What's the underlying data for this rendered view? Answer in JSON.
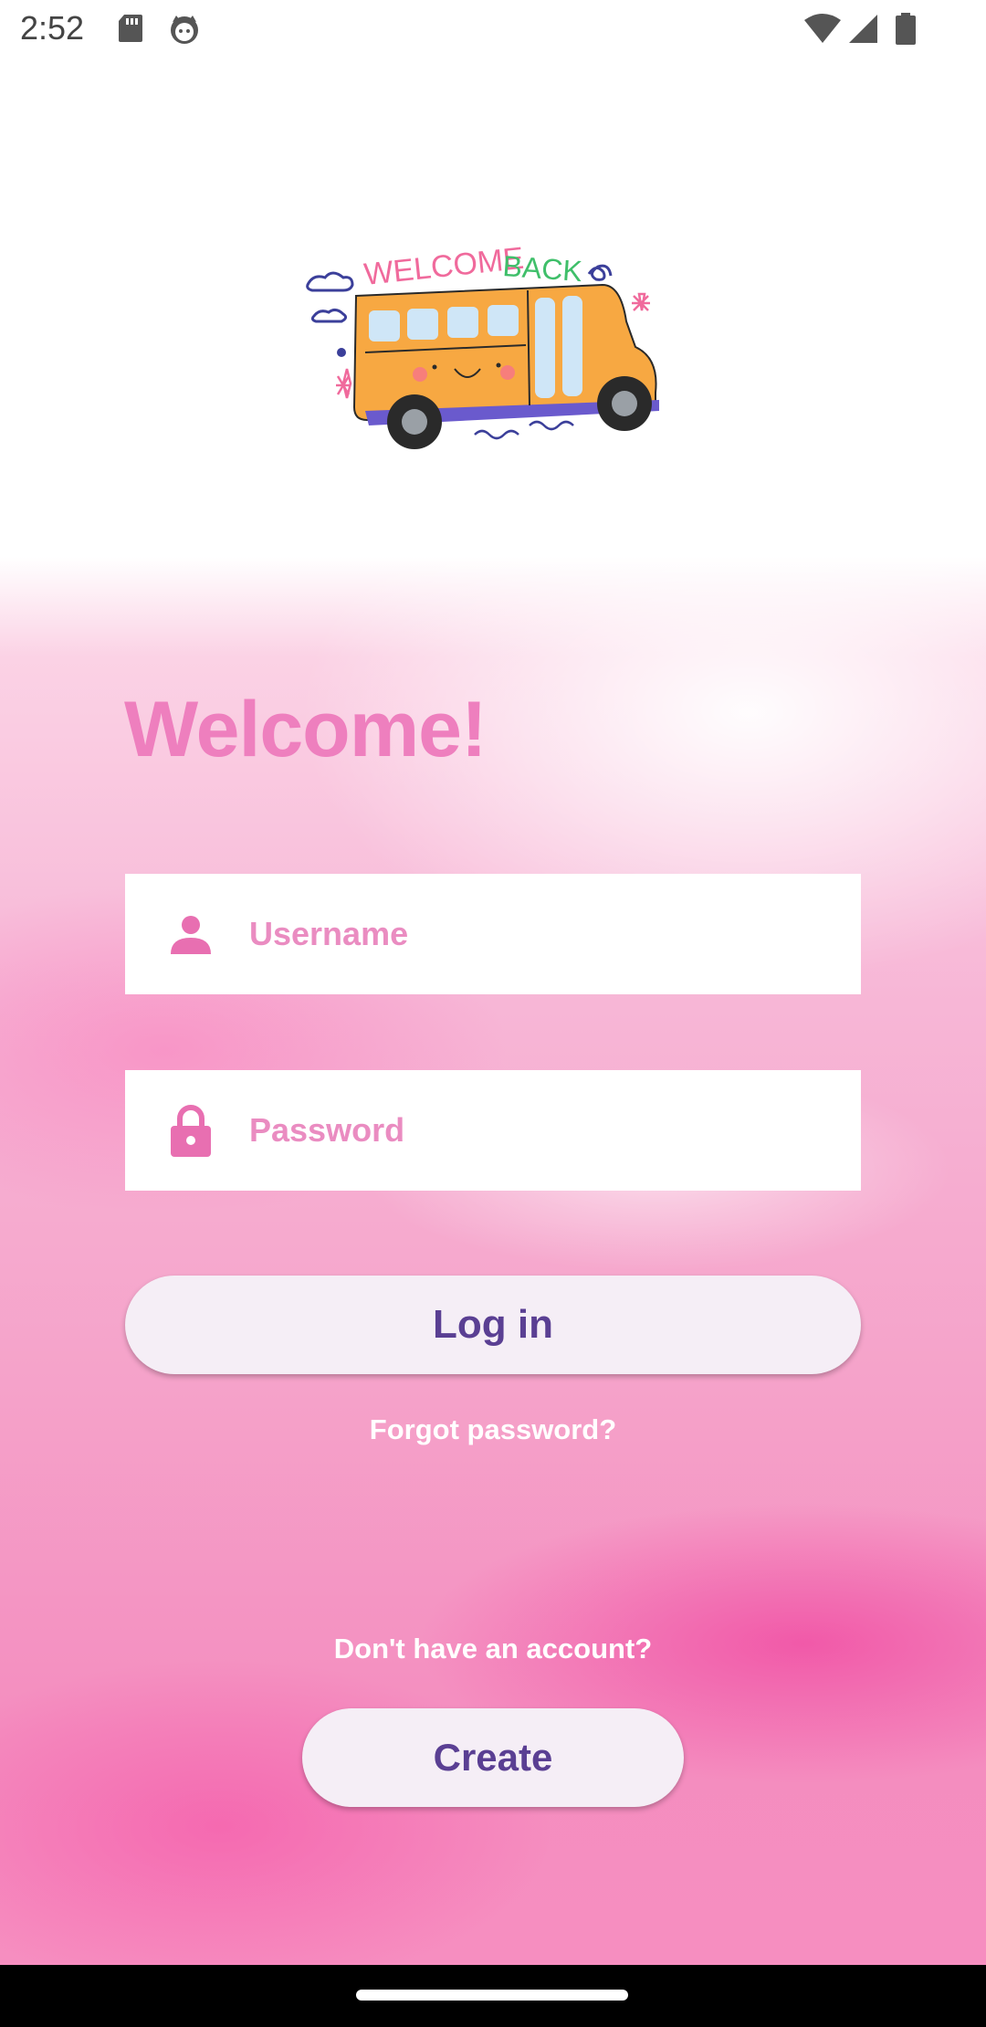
{
  "status_bar": {
    "time": "2:52",
    "icons": [
      "sd-card-icon",
      "cat-face-icon",
      "wifi-icon",
      "signal-icon",
      "battery-icon"
    ]
  },
  "logo": {
    "text_line_1": "WELCOME",
    "text_line_2": "BACK",
    "colors": {
      "welcome": "#f06a9c",
      "back": "#3fbf6a",
      "bus": "#f7a842",
      "windows": "#cfe6f7",
      "stripe": "#6a5acd"
    }
  },
  "form": {
    "title": "Welcome!",
    "username": {
      "placeholder": "Username",
      "value": "",
      "icon": "person-icon"
    },
    "password": {
      "placeholder": "Password",
      "value": "",
      "icon": "lock-icon"
    },
    "login_label": "Log in",
    "forgot_label": "Forgot password?"
  },
  "signup": {
    "prompt": "Don't have an account?",
    "create_label": "Create"
  },
  "colors": {
    "accent_pink": "#ee7fbe",
    "button_bg": "#f5eef6",
    "button_text": "#5a3f93"
  }
}
